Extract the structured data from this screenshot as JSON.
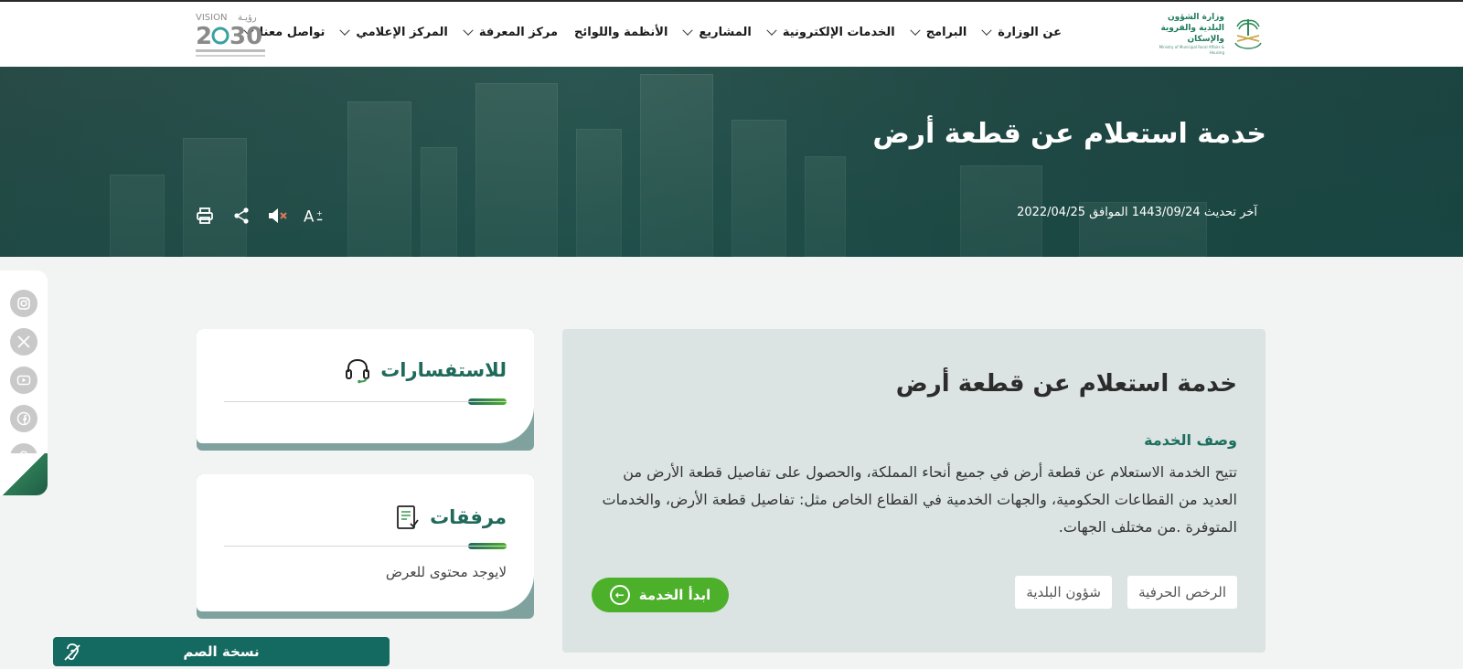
{
  "header": {
    "ministry_logo_text": "وزارة الشؤون البلدية والقروية والإسكان",
    "ministry_logo_sub": "Ministry of Municipal Rural Affairs & Housing",
    "vision_logo_text": "VISION 2030",
    "nav": [
      {
        "label": "عن الوزارة"
      },
      {
        "label": "البرامج"
      },
      {
        "label": "الخدمات الإلكترونية"
      },
      {
        "label": "المشاريع"
      },
      {
        "label": "الأنظمة واللوائح"
      },
      {
        "label": "مركز المعرفة"
      },
      {
        "label": "المركز الإعلامي"
      },
      {
        "label": "تواصل معنا"
      }
    ]
  },
  "hero": {
    "title": "خدمة استعلام عن قطعة أرض",
    "last_update": "آخر تحديث 1443/09/24 الموافق 2022/04/25",
    "tools": [
      "font-size-icon",
      "mute-icon",
      "share-icon",
      "print-icon"
    ]
  },
  "social": [
    "instagram-icon",
    "x-icon",
    "youtube-icon",
    "facebook-icon",
    "snapchat-icon"
  ],
  "service": {
    "title": "خدمة استعلام عن قطعة أرض",
    "desc_heading": "وصف الخدمة",
    "description": "تتيح الخدمة الاستعلام عن قطعة أرض في جميع أنحاء المملكة، والحصول على تفاصيل قطعة الأرض من العديد من القطاعات الحكومية، والجهات الخدمية في القطاع الخاص مثل: تفاصيل قطعة الأرض، والخدمات المتوفرة .من مختلف الجهات.",
    "tags": [
      "الرخص الحرفية",
      "شؤون البلدية"
    ],
    "start_button": "ابدأ الخدمة"
  },
  "inquiries": {
    "title": "للاستفسارات"
  },
  "attachments": {
    "title": "مرفقات",
    "empty_text": "لايوجد محتوى للعرض"
  },
  "deaf_version": {
    "label": "نسخة الصم"
  },
  "colors": {
    "primary": "#1f6a5a",
    "accent_green": "#4cb02a",
    "deaf_bar": "#146a60"
  }
}
